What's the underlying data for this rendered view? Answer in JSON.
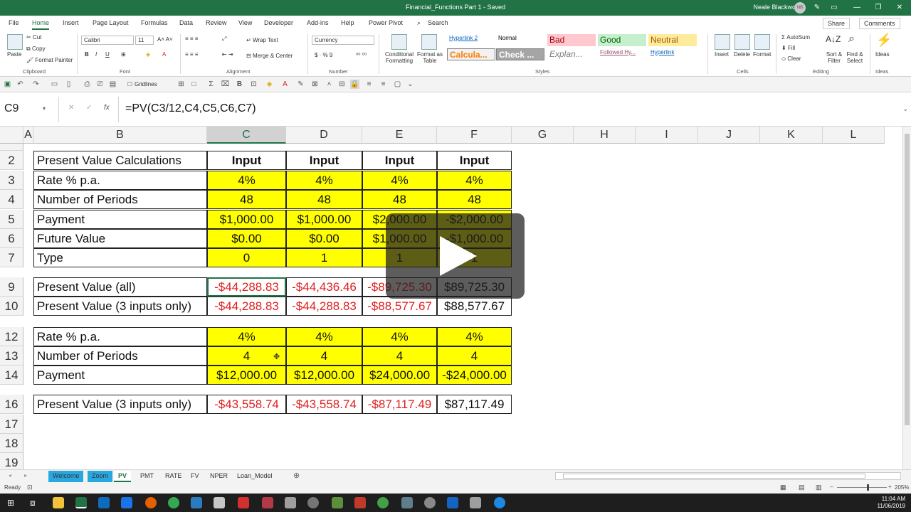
{
  "window": {
    "title": "Financial_Functions Part 1  -  Saved",
    "user": "Neale Blackwood",
    "avatar_initials": "NB"
  },
  "ribbon_tabs": [
    "File",
    "Home",
    "Insert",
    "Page Layout",
    "Formulas",
    "Data",
    "Review",
    "View",
    "Developer",
    "Add-ins",
    "Help",
    "Power Pivot"
  ],
  "search_label": "Search",
  "share_label": "Share",
  "comments_label": "Comments",
  "ribbon": {
    "clipboard": {
      "paste": "Paste",
      "cut": "Cut",
      "copy": "Copy",
      "format_painter": "Format Painter",
      "group": "Clipboard"
    },
    "font": {
      "name": "Calibri",
      "size": "11",
      "group": "Font"
    },
    "alignment": {
      "wrap_text": "Wrap Text",
      "merge_center": "Merge & Center",
      "group": "Alignment"
    },
    "number": {
      "format": "Currency",
      "group": "Number"
    },
    "styles": {
      "conditional": "Conditional Formatting",
      "format_table": "Format as Table",
      "cells": [
        {
          "label": "Hyperlink 2",
          "color": "#0563c1",
          "bg": "#ffffff"
        },
        {
          "label": "Normal",
          "color": "#000000",
          "bg": "#ffffff"
        },
        {
          "label": "Bad",
          "color": "#9c0006",
          "bg": "#ffc7ce"
        },
        {
          "label": "Good",
          "color": "#006100",
          "bg": "#c6efce"
        },
        {
          "label": "Neutral",
          "color": "#9c5700",
          "bg": "#ffeb9c"
        },
        {
          "label": "Calcula...",
          "color": "#fa7d00",
          "bg": "#f2f2f2"
        },
        {
          "label": "Check ...",
          "color": "#ffffff",
          "bg": "#a5a5a5"
        },
        {
          "label": "Explan...",
          "color": "#7f7f7f",
          "bg": "#ffffff"
        },
        {
          "label": "Followed Hy...",
          "color": "#954f72",
          "bg": "#ffffff"
        },
        {
          "label": "Hyperlink",
          "color": "#0563c1",
          "bg": "#ffffff"
        }
      ],
      "group": "Styles"
    },
    "cells": {
      "insert": "Insert",
      "delete": "Delete",
      "format": "Format",
      "group": "Cells"
    },
    "editing": {
      "autosum": "AutoSum",
      "fill": "Fill",
      "clear": "Clear",
      "sort": "Sort & Filter",
      "find": "Find & Select",
      "group": "Editing"
    },
    "ideas": {
      "label": "Ideas",
      "group": "Ideas"
    }
  },
  "qat": {
    "gridlines": "Gridlines"
  },
  "formula_bar": {
    "name_box": "C9",
    "formula": "=PV(C3/12,C4,C5,C6,C7)"
  },
  "columns": [
    "A",
    "B",
    "C",
    "D",
    "E",
    "F",
    "G",
    "H",
    "I",
    "J",
    "K",
    "L"
  ],
  "rows": [
    {
      "num": "2",
      "cells": [
        "Present Value Calculations",
        "Input",
        "Input",
        "Input",
        "Input"
      ],
      "style": "header"
    },
    {
      "num": "3",
      "cells": [
        "Rate % p.a.",
        "4%",
        "4%",
        "4%",
        "4%"
      ],
      "style": "input"
    },
    {
      "num": "4",
      "cells": [
        "Number of Periods",
        "48",
        "48",
        "48",
        "48"
      ],
      "style": "input"
    },
    {
      "num": "5",
      "cells": [
        "Payment",
        "$1,000.00",
        "$1,000.00",
        "$2,000.00",
        "-$2,000.00"
      ],
      "style": "input"
    },
    {
      "num": "6",
      "cells": [
        "Future Value",
        "$0.00",
        "$0.00",
        "$1,000.00",
        "-$1,000.00"
      ],
      "style": "input"
    },
    {
      "num": "7",
      "cells": [
        "Type",
        "0",
        "1",
        "1",
        "1"
      ],
      "style": "input"
    },
    {
      "num": "9",
      "cells": [
        "Present Value (all)",
        "-$44,288.83",
        "-$44,436.46",
        "-$89,725.30",
        "$89,725.30"
      ],
      "style": "result"
    },
    {
      "num": "10",
      "cells": [
        "Present Value (3 inputs only)",
        "-$44,288.83",
        "-$44,288.83",
        "-$88,577.67",
        "$88,577.67"
      ],
      "style": "result"
    },
    {
      "num": "12",
      "cells": [
        "Rate % p.a.",
        "4%",
        "4%",
        "4%",
        "4%"
      ],
      "style": "input"
    },
    {
      "num": "13",
      "cells": [
        "Number of Periods",
        "4",
        "4",
        "4",
        "4"
      ],
      "style": "input"
    },
    {
      "num": "14",
      "cells": [
        "Payment",
        "$12,000.00",
        "$12,000.00",
        "$24,000.00",
        "-$24,000.00"
      ],
      "style": "input"
    },
    {
      "num": "16",
      "cells": [
        "Present Value (3 inputs only)",
        "-$43,558.74",
        "-$43,558.74",
        "-$87,117.49",
        "$87,117.49"
      ],
      "style": "result"
    },
    {
      "num": "17",
      "cells": [
        "",
        "",
        "",
        "",
        ""
      ],
      "style": "empty"
    },
    {
      "num": "18",
      "cells": [
        "",
        "",
        "",
        "",
        ""
      ],
      "style": "empty"
    },
    {
      "num": "19",
      "cells": [
        "",
        "",
        "",
        "",
        ""
      ],
      "style": "empty"
    }
  ],
  "sheet_tabs": [
    {
      "label": "Welcome",
      "style": "blue"
    },
    {
      "label": "Zoom",
      "style": "blue"
    },
    {
      "label": "PV",
      "style": "active"
    },
    {
      "label": "PMT",
      "style": "normal"
    },
    {
      "label": "RATE",
      "style": "normal"
    },
    {
      "label": "FV",
      "style": "normal"
    },
    {
      "label": "NPER",
      "style": "normal"
    },
    {
      "label": "Loan_Model",
      "style": "normal"
    }
  ],
  "status": {
    "ready": "Ready",
    "zoom": "205%"
  },
  "clock": {
    "time": "11:04 AM",
    "date": "11/06/2019"
  },
  "colors": {
    "excel_green": "#217346",
    "input_yellow": "#ffff00",
    "negative_red": "#e02020"
  }
}
